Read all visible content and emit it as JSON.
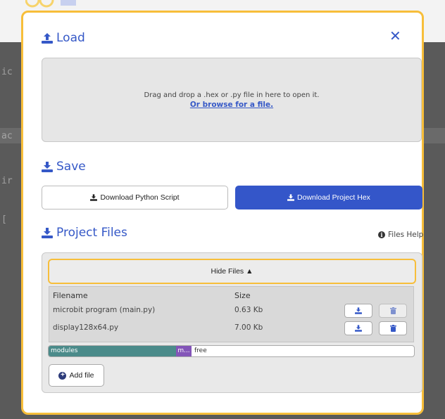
{
  "background": {
    "code_lines": [
      "ic",
      "ac",
      "ir",
      "["
    ]
  },
  "modal": {
    "load": {
      "title": "Load",
      "icon": "upload-icon",
      "close_symbol": "✕"
    },
    "dropzone": {
      "text": "Drag and drop a .hex or .py file in here to open it.",
      "browse": "Or browse for a file."
    },
    "save": {
      "title": "Save",
      "icon": "download-icon",
      "download_python": "Download Python Script",
      "download_hex": "Download Project Hex"
    },
    "project_files": {
      "title": "Project Files",
      "help": "Files Help",
      "hide_files": "Hide Files ▲",
      "columns": [
        "Filename",
        "Size"
      ],
      "files": [
        {
          "name": "microbit program (main.py)",
          "size": "0.63 Kb"
        },
        {
          "name": "display128x64.py",
          "size": "7.00 Kb"
        }
      ],
      "memory": {
        "modules": "modules",
        "main": "m...",
        "free": "free"
      },
      "add_file": "Add file"
    }
  },
  "colors": {
    "accent": "#3558c7",
    "highlight": "#f7be3a",
    "modules": "#4b8b8a",
    "main": "#8355b8"
  }
}
